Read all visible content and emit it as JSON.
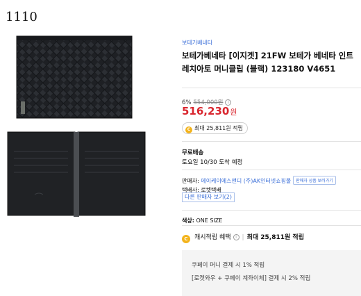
{
  "product_id": "1110",
  "product": {
    "brand": "보테가베네타",
    "title": "보테가베네타 [이지겟] 21FW 보테가 베네타 인트레치아토 머니클립 (블랙) 123180 V4651"
  },
  "price": {
    "discount": "6%",
    "original": "554,000원",
    "final_number": "516,230",
    "final_unit": "원"
  },
  "reward_pill": {
    "icon_text": "C",
    "text": "최대 25,811원 적립"
  },
  "shipping": {
    "title": "무료배송",
    "date": "토요일 10/30 도착 예정"
  },
  "seller": {
    "label": "판매자: ",
    "name": "에이케이에스앤디 (주)AK인터넷쇼핑몰",
    "button": "판매자 상품 보러가기",
    "courier": "택배사: 로켓택배",
    "other_sellers": "다른 판매자 보기(2)"
  },
  "option": {
    "label": "색상:",
    "value": "ONE SIZE"
  },
  "cash": {
    "icon_text": "C",
    "label": "캐시적립 혜택",
    "info_icon": "i",
    "separator": "|",
    "max": "최대 25,811원 적립"
  },
  "coupay": {
    "line1": "쿠페이 머니 결제 시 1% 적립",
    "line2": "[로켓와우 + 쿠페이 계좌이체] 결제 시 2% 적립"
  },
  "colors": {
    "accent_blue": "#3b6fd8",
    "price_red": "#d9262e",
    "coin_yellow": "#f3b31b",
    "wallet_black": "#1c1d1f"
  },
  "icons": [
    "info-icon",
    "coin-icon",
    "wallet-closed-image",
    "wallet-open-image"
  ]
}
